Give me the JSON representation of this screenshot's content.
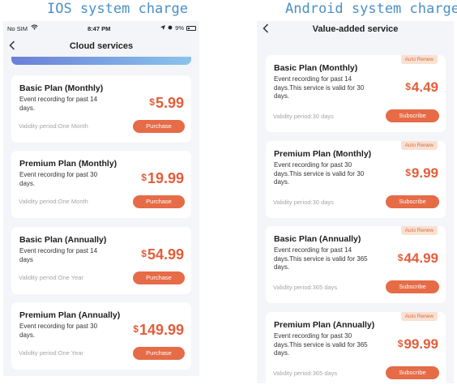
{
  "headings": {
    "ios": "IOS system charge",
    "android": "Android system charge"
  },
  "ios": {
    "status": {
      "carrier": "No SIM",
      "time": "8:47 PM",
      "battery": "9%"
    },
    "title": "Cloud services",
    "plans": [
      {
        "name": "Basic Plan (Monthly)",
        "desc": "Event recording for past 14 days.",
        "currency": "$",
        "amount": "5.99",
        "validity": "Validity period:One Month",
        "button": "Purchase"
      },
      {
        "name": "Premium Plan (Monthly)",
        "desc": "Event recording for past 30 days.",
        "currency": "$",
        "amount": "19.99",
        "validity": "Validity period:One Month",
        "button": "Purchase"
      },
      {
        "name": "Basic Plan (Annually)",
        "desc": "Event recording for past 14 days",
        "currency": "$",
        "amount": "54.99",
        "validity": "Validity period:One Year",
        "button": "Purchase"
      },
      {
        "name": "Premium Plan (Annually)",
        "desc": "Event recording for past 30 days.",
        "currency": "$",
        "amount": "149.99",
        "validity": "Validity period:One Year",
        "button": "Purchase"
      }
    ]
  },
  "android": {
    "title": "Value-added service",
    "plans": [
      {
        "badge": "Auto Renew",
        "name": "Basic Plan (Monthly)",
        "desc": "Event recording for past 14 days.This service is valid for 30 days.",
        "currency": "$",
        "amount": "4.49",
        "validity": "Validity period:30 days",
        "button": "Subscribe"
      },
      {
        "badge": "Auto Renew",
        "name": "Premium Plan (Monthly)",
        "desc": "Event recording for past 30 days.This service is valid for 30 days.",
        "currency": "$",
        "amount": "9.99",
        "validity": "Validity period:30 days",
        "button": "Subscribe"
      },
      {
        "badge": "Auto Renew",
        "name": "Basic Plan (Annually)",
        "desc": "Event recording for past 14 days.This service is valid for 365 days.",
        "currency": "$",
        "amount": "44.99",
        "validity": "Validity period:365 days",
        "button": "Subscribe"
      },
      {
        "badge": "Auto Renew",
        "name": "Premium Plan (Annually)",
        "desc": "Event recording for past 30 days.This service is valid for 365 days.",
        "currency": "$",
        "amount": "99.99",
        "validity": "Validity period:365 days",
        "button": "Subscribe"
      }
    ]
  },
  "icons": {
    "back": "chevron-left-icon",
    "wifi": "wifi-icon",
    "location": "location-arrow-icon",
    "battery": "battery-icon"
  },
  "colors": {
    "accent": "#e66b47",
    "price": "#e35d3a",
    "heading": "#4a8fc8",
    "badge_bg": "#f9e1d2",
    "badge_text": "#d56a3f",
    "screen_bg": "#f3f5f8"
  }
}
